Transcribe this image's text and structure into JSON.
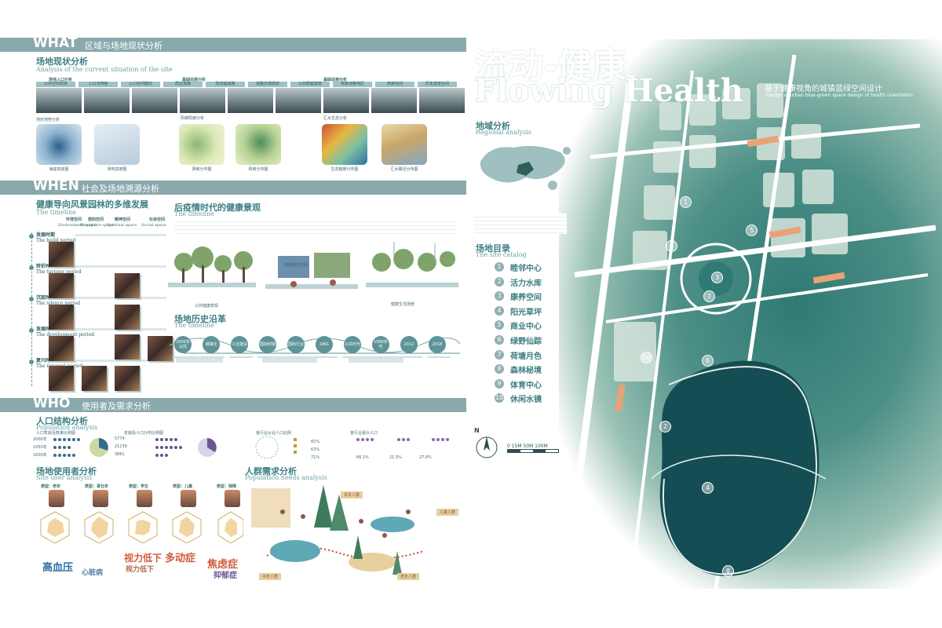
{
  "what": {
    "label": "WHAT",
    "subtitle": "区域与场地现状分析"
  },
  "site_status": {
    "title_cn": "场地现状分析",
    "title_en": "Analysis of the current situation of the site"
  },
  "photo_groups": [
    "场地入口分析",
    "基础设施分析",
    "基础设施分析"
  ],
  "photo_tags": [
    "公共空间现状",
    "入口无特色",
    "入口空间破旧",
    "周边道路",
    "防洪堤道路",
    "道路交通现状",
    "公共配套建筑",
    "荒废道路地区",
    "高架空间",
    "历史遗迹空间"
  ],
  "terrain_caps": {
    "map1": "地形地势分析",
    "map3": "阴坡阳坡分析",
    "map5": "汇水生态分析"
  },
  "terrain_captions": [
    "海拔高度图",
    "场地高度图",
    "阴坡分布图",
    "阳坡分布图",
    "生态植被分布图",
    "汇水路径分布图"
  ],
  "when": {
    "label": "WHEN",
    "subtitle": "社会及场地溯源分析"
  },
  "healthy_dev": {
    "title_cn": "健康导向风景园林的多维发展",
    "title_en": "The timeline"
  },
  "space_types": [
    {
      "cn": "环境空间",
      "en": "Environment space"
    },
    {
      "cn": "感知空间",
      "en": "Perceptive space"
    },
    {
      "cn": "精神空间",
      "en": "Spiritual space"
    },
    {
      "cn": "社会空间",
      "en": "Social space"
    }
  ],
  "periods": [
    {
      "cn": "发展时期",
      "en": "The build period"
    },
    {
      "cn": "转折时期",
      "en": "The turning period"
    },
    {
      "cn": "沉寂时期",
      "en": "The silence period"
    },
    {
      "cn": "发展时期",
      "en": "The development period"
    },
    {
      "cn": "复兴时期",
      "en": "The renewal period"
    }
  ],
  "post_epidemic": {
    "title_cn": "后疫情时代的健康景观",
    "title_en": "The timeline"
  },
  "scene_labels": [
    "公共健康景观",
    "健康城市景观",
    "健康生活场景"
  ],
  "history": {
    "title_cn": "场地历史沿革",
    "title_en": "The timeline"
  },
  "timeline_nodes": [
    "2000年以前",
    "城镇化",
    "工业建设",
    "国际时期",
    "国际行业",
    "1961",
    "公共时代",
    "1990年代",
    "2012",
    "2018"
  ],
  "who": {
    "label": "WHO",
    "subtitle": "使用者及需求分析"
  },
  "population": {
    "title_cn": "人口结构分析",
    "title_en": "Population analysis"
  },
  "pop_blocks": [
    "人口年龄及数量比例图",
    "年龄段人口分布比例图",
    "各行业从业人口比例",
    "各行业受众人口"
  ],
  "pop_values": [
    "2000年",
    "1950年",
    "1600年",
    "5774",
    "21239",
    "3861",
    "82%",
    "63%",
    "71%",
    "66.1%",
    "21.5%",
    "27.8%"
  ],
  "site_user": {
    "title_cn": "场地使用者分析",
    "title_en": "Site user analysis"
  },
  "user_types": [
    "类型：老年",
    "类型：青壮年",
    "类型：学生",
    "类型：儿童",
    "类型：残障"
  ],
  "words": [
    "高血压",
    "视力低下",
    "多动症",
    "焦虑症",
    "抑郁症",
    "心脏病",
    "视力低下"
  ],
  "needs": {
    "title_cn": "人群需求分析",
    "title_en": "Population needs analysis"
  },
  "needs_tags": [
    "青年人群",
    "中年人群",
    "老年人群",
    "儿童人群"
  ],
  "hero": {
    "title_cn": "流动-健康",
    "title_en": "Flowing Health",
    "subtitle_cn": "基于健康视角的城镇蓝绿空间设计",
    "subtitle_en": "Design of urban blue-green space design of health orientation"
  },
  "regional": {
    "title_cn": "地域分析",
    "title_en": "Regional analysis"
  },
  "catalog": {
    "title_cn": "场地目录",
    "title_en": "The site catalog",
    "items": [
      "睦邻中心",
      "活力水库",
      "康养空间",
      "阳光草坪",
      "商业中心",
      "绿野仙踪",
      "荷塘月色",
      "森林秘境",
      "体育中心",
      "休闲水镜"
    ]
  },
  "map_numbers": [
    "1",
    "2",
    "3",
    "4",
    "5",
    "6",
    "7",
    "8",
    "9",
    "10"
  ],
  "scale": {
    "north": "N",
    "label": "0 15M 50M 100M"
  },
  "colors": {
    "band": "#8aa9ac",
    "accent": "#3e7f82",
    "map_green": "#2f7a74",
    "water": "#1c5e63",
    "road": "#ffffff",
    "orange": "#e9a275"
  }
}
